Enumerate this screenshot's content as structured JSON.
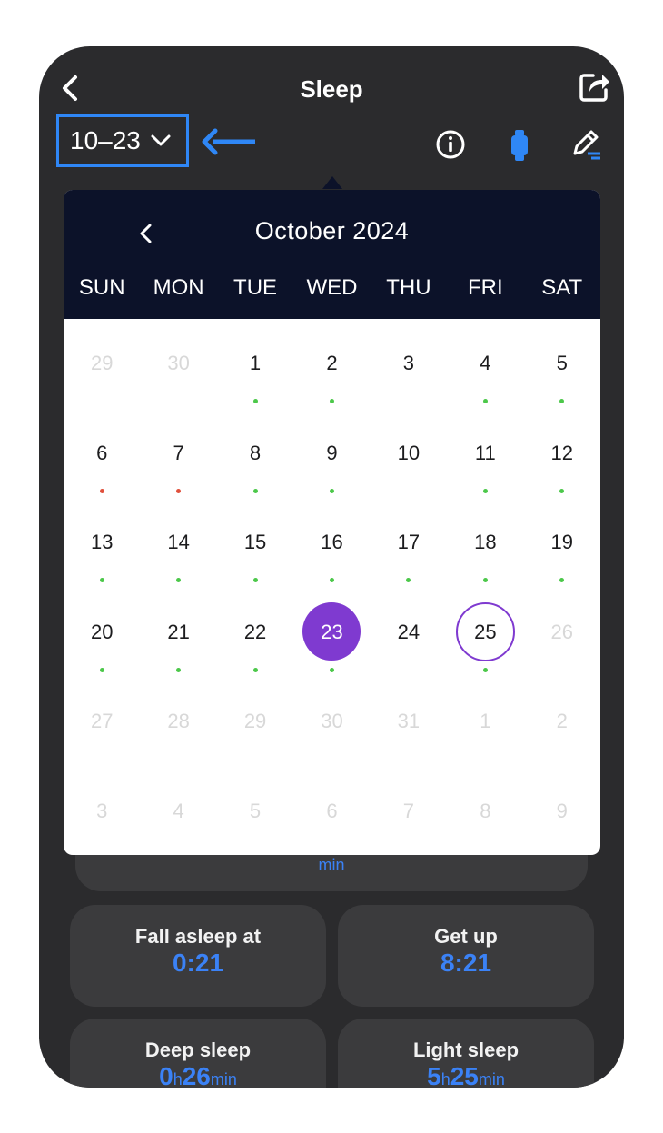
{
  "header": {
    "title": "Sleep"
  },
  "date_selector": {
    "label": "10–23"
  },
  "calendar": {
    "month_title": "October 2024",
    "weekdays": [
      "SUN",
      "MON",
      "TUE",
      "WED",
      "THU",
      "FRI",
      "SAT"
    ],
    "days": [
      {
        "d": "29",
        "muted": true,
        "dot": null
      },
      {
        "d": "30",
        "muted": true,
        "dot": null
      },
      {
        "d": "1",
        "dot": "green"
      },
      {
        "d": "2",
        "dot": "green"
      },
      {
        "d": "3",
        "dot": null
      },
      {
        "d": "4",
        "dot": "green"
      },
      {
        "d": "5",
        "dot": "green"
      },
      {
        "d": "6",
        "dot": "red"
      },
      {
        "d": "7",
        "dot": "red"
      },
      {
        "d": "8",
        "dot": "green"
      },
      {
        "d": "9",
        "dot": "green"
      },
      {
        "d": "10",
        "dot": null
      },
      {
        "d": "11",
        "dot": "green"
      },
      {
        "d": "12",
        "dot": "green"
      },
      {
        "d": "13",
        "dot": "green"
      },
      {
        "d": "14",
        "dot": "green"
      },
      {
        "d": "15",
        "dot": "green"
      },
      {
        "d": "16",
        "dot": "green"
      },
      {
        "d": "17",
        "dot": "green"
      },
      {
        "d": "18",
        "dot": "green"
      },
      {
        "d": "19",
        "dot": "green"
      },
      {
        "d": "20",
        "dot": "green"
      },
      {
        "d": "21",
        "dot": "green"
      },
      {
        "d": "22",
        "dot": "green"
      },
      {
        "d": "23",
        "dot": "green",
        "selected": true
      },
      {
        "d": "24",
        "dot": null
      },
      {
        "d": "25",
        "dot": "green",
        "today": true
      },
      {
        "d": "26",
        "muted": true,
        "dot": null
      },
      {
        "d": "27",
        "muted": true,
        "dot": null
      },
      {
        "d": "28",
        "muted": true,
        "dot": null
      },
      {
        "d": "29",
        "muted": true,
        "dot": null
      },
      {
        "d": "30",
        "muted": true,
        "dot": null
      },
      {
        "d": "31",
        "muted": true,
        "dot": null
      },
      {
        "d": "1",
        "muted": true,
        "dot": null
      },
      {
        "d": "2",
        "muted": true,
        "dot": null
      },
      {
        "d": "3",
        "muted": true,
        "dot": null
      },
      {
        "d": "4",
        "muted": true,
        "dot": null
      },
      {
        "d": "5",
        "muted": true,
        "dot": null
      },
      {
        "d": "6",
        "muted": true,
        "dot": null
      },
      {
        "d": "7",
        "muted": true,
        "dot": null
      },
      {
        "d": "8",
        "muted": true,
        "dot": null
      },
      {
        "d": "9",
        "muted": true,
        "dot": null
      }
    ]
  },
  "cards": {
    "total": {
      "value_unit": "min"
    },
    "fall_asleep": {
      "label": "Fall asleep at",
      "value": "0:21"
    },
    "get_up": {
      "label": "Get up",
      "value": "8:21"
    },
    "deep_sleep": {
      "label": "Deep sleep",
      "hours": "0",
      "h_unit": "h",
      "minutes": "26",
      "min_unit": "min"
    },
    "light_sleep": {
      "label": "Light sleep",
      "hours": "5",
      "h_unit": "h",
      "minutes": "25",
      "min_unit": "min"
    }
  },
  "colors": {
    "accent": "#3b82f6",
    "highlight_border": "#2f87f6",
    "selected_day": "#7f3ad0",
    "dot_green": "#4cc84a",
    "dot_red": "#e0503c",
    "calendar_header": "#0c1229",
    "background": "#2b2b2d",
    "card": "#3b3b3d"
  },
  "icons": [
    "back-icon",
    "share-icon",
    "chevron-down-icon",
    "arrow-left-icon",
    "info-icon",
    "watch-icon",
    "edit-icon",
    "chevron-left-icon"
  ]
}
